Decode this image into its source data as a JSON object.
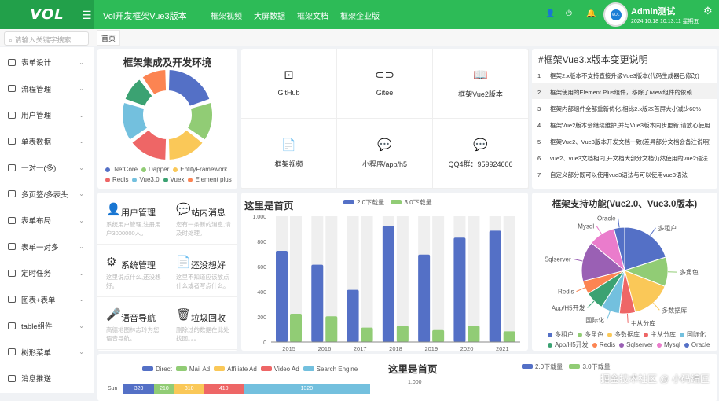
{
  "header": {
    "logo": "VOL",
    "title": "Vol开发框架Vue3版本",
    "nav": [
      "框架视频",
      "大屏数据",
      "框架文档",
      "框架企业版"
    ],
    "user": "Admin测试",
    "datetime": "2024.10.18 10:13:11 星期五",
    "avatar_text": "VOL"
  },
  "search": {
    "placeholder": "请输入关键字搜索..."
  },
  "tabs": [
    "首页"
  ],
  "sidebar": [
    "表单设计",
    "流程管理",
    "用户管理",
    "单表数据",
    "一对一(多)",
    "多页签/多表头",
    "表单布局",
    "表单一对多",
    "定时任务",
    "图表+表单",
    "table组件",
    "树形菜单",
    "消息推送"
  ],
  "links": [
    {
      "label": "GitHub",
      "icon": "github-icon"
    },
    {
      "label": "Gitee",
      "icon": "gitee-icon"
    },
    {
      "label": "框架Vue2版本",
      "icon": "book-icon"
    },
    {
      "label": "框架视频",
      "icon": "document-icon"
    },
    {
      "label": "小程序/app/h5",
      "icon": "chat-icon"
    },
    {
      "label": "QQ4群：959924606",
      "icon": "qq-icon"
    }
  ],
  "changelog": {
    "title": "#框架Vue3.x版本变更说明",
    "items": [
      "框架2.x版本不支持直接升级Vue3版本(代码生成器已修改)",
      "框架使用的Element Plus组件，移除了iview组件的依赖",
      "框架内部组件全部重新优化,相比2.x版本首屏大小减少60%",
      "框架Vue2版本会继续维护,并与Vue3版本同步更新,请放心使用",
      "框架Vue2、Vue3版本开发文档一致(差异部分文档会备注说明)",
      "vue2、vue3文档相同,开文档大部分文档仍然使用的vue2语法",
      "自定义部分既可以使用vue3语法与可以使用vue3语法"
    ]
  },
  "features": [
    {
      "title": "用户管理",
      "desc": "系统用户管理,注册用户3000000人。"
    },
    {
      "title": "站内消息",
      "desc": "您有一条新的消息,请及时处理。"
    },
    {
      "title": "系统管理",
      "desc": "这里说点什么,还没想好。"
    },
    {
      "title": "还没想好",
      "desc": "这里不知道应该放点什么或者写点什么。"
    },
    {
      "title": "语音导航",
      "desc": "高德地图林志玲为您语音导航。"
    },
    {
      "title": "垃圾回收",
      "desc": "删除过的数据在此处找回。。。"
    }
  ],
  "colors": {
    "header": "#2dbb57",
    "blue": "#5470c6",
    "green": "#91cc75",
    "yellow": "#fac858",
    "red": "#ee6666",
    "cyan": "#73c0de",
    "teal": "#3ba272",
    "orange": "#fc8452",
    "purple": "#9a60b4",
    "pink": "#ea7ccc"
  },
  "chart_data": [
    {
      "type": "pie",
      "title": "框架集成及开发环境",
      "donut": true,
      "labels": [
        ".NetCore",
        "Dapper",
        "EntityFramework",
        "Redis",
        "Vue3.0",
        "Vuex",
        "Element plus"
      ],
      "values": [
        20,
        15,
        15,
        15,
        15,
        10,
        10
      ]
    },
    {
      "type": "bar",
      "title": "这里是首页",
      "categories": [
        "2015",
        "2016",
        "2017",
        "2018",
        "2019",
        "2020",
        "2021"
      ],
      "series": [
        {
          "name": "2.0下载量",
          "values": [
            725,
            615,
            415,
            925,
            695,
            830,
            885
          ]
        },
        {
          "name": "3.0下载量",
          "values": [
            225,
            205,
            115,
            130,
            95,
            130,
            85
          ]
        }
      ],
      "ylim": [
        0,
        1000
      ],
      "yticks": [
        "0",
        "200",
        "400",
        "600",
        "800",
        "1,000"
      ]
    },
    {
      "type": "pie",
      "title": "框架支持功能(Vue2.0、Vue3.0版本)",
      "labels": [
        "多租户",
        "多角色",
        "多数据库",
        "主从分库",
        "国际化",
        "App/H5开发",
        "Redis",
        "Sqlserver",
        "Mysql",
        "Oracle"
      ],
      "values": [
        20,
        11,
        15,
        6,
        7,
        7,
        5,
        15,
        10,
        4
      ]
    },
    {
      "type": "bar",
      "stacked": true,
      "orientation": "horizontal",
      "legend": [
        "Direct",
        "Mail Ad",
        "Affiliate Ad",
        "Video Ad",
        "Search Engine"
      ],
      "categories": [
        "Sun"
      ],
      "values": [
        [
          320
        ],
        [
          210
        ],
        [
          310
        ],
        [
          410
        ],
        [
          1320
        ]
      ]
    },
    {
      "type": "bar",
      "title": "这里是首页",
      "legend": [
        "2.0下载量",
        "3.0下载量"
      ],
      "yticks": [
        "1,000"
      ]
    }
  ],
  "watermark": "掘金技术社区 @ 小码编匠"
}
